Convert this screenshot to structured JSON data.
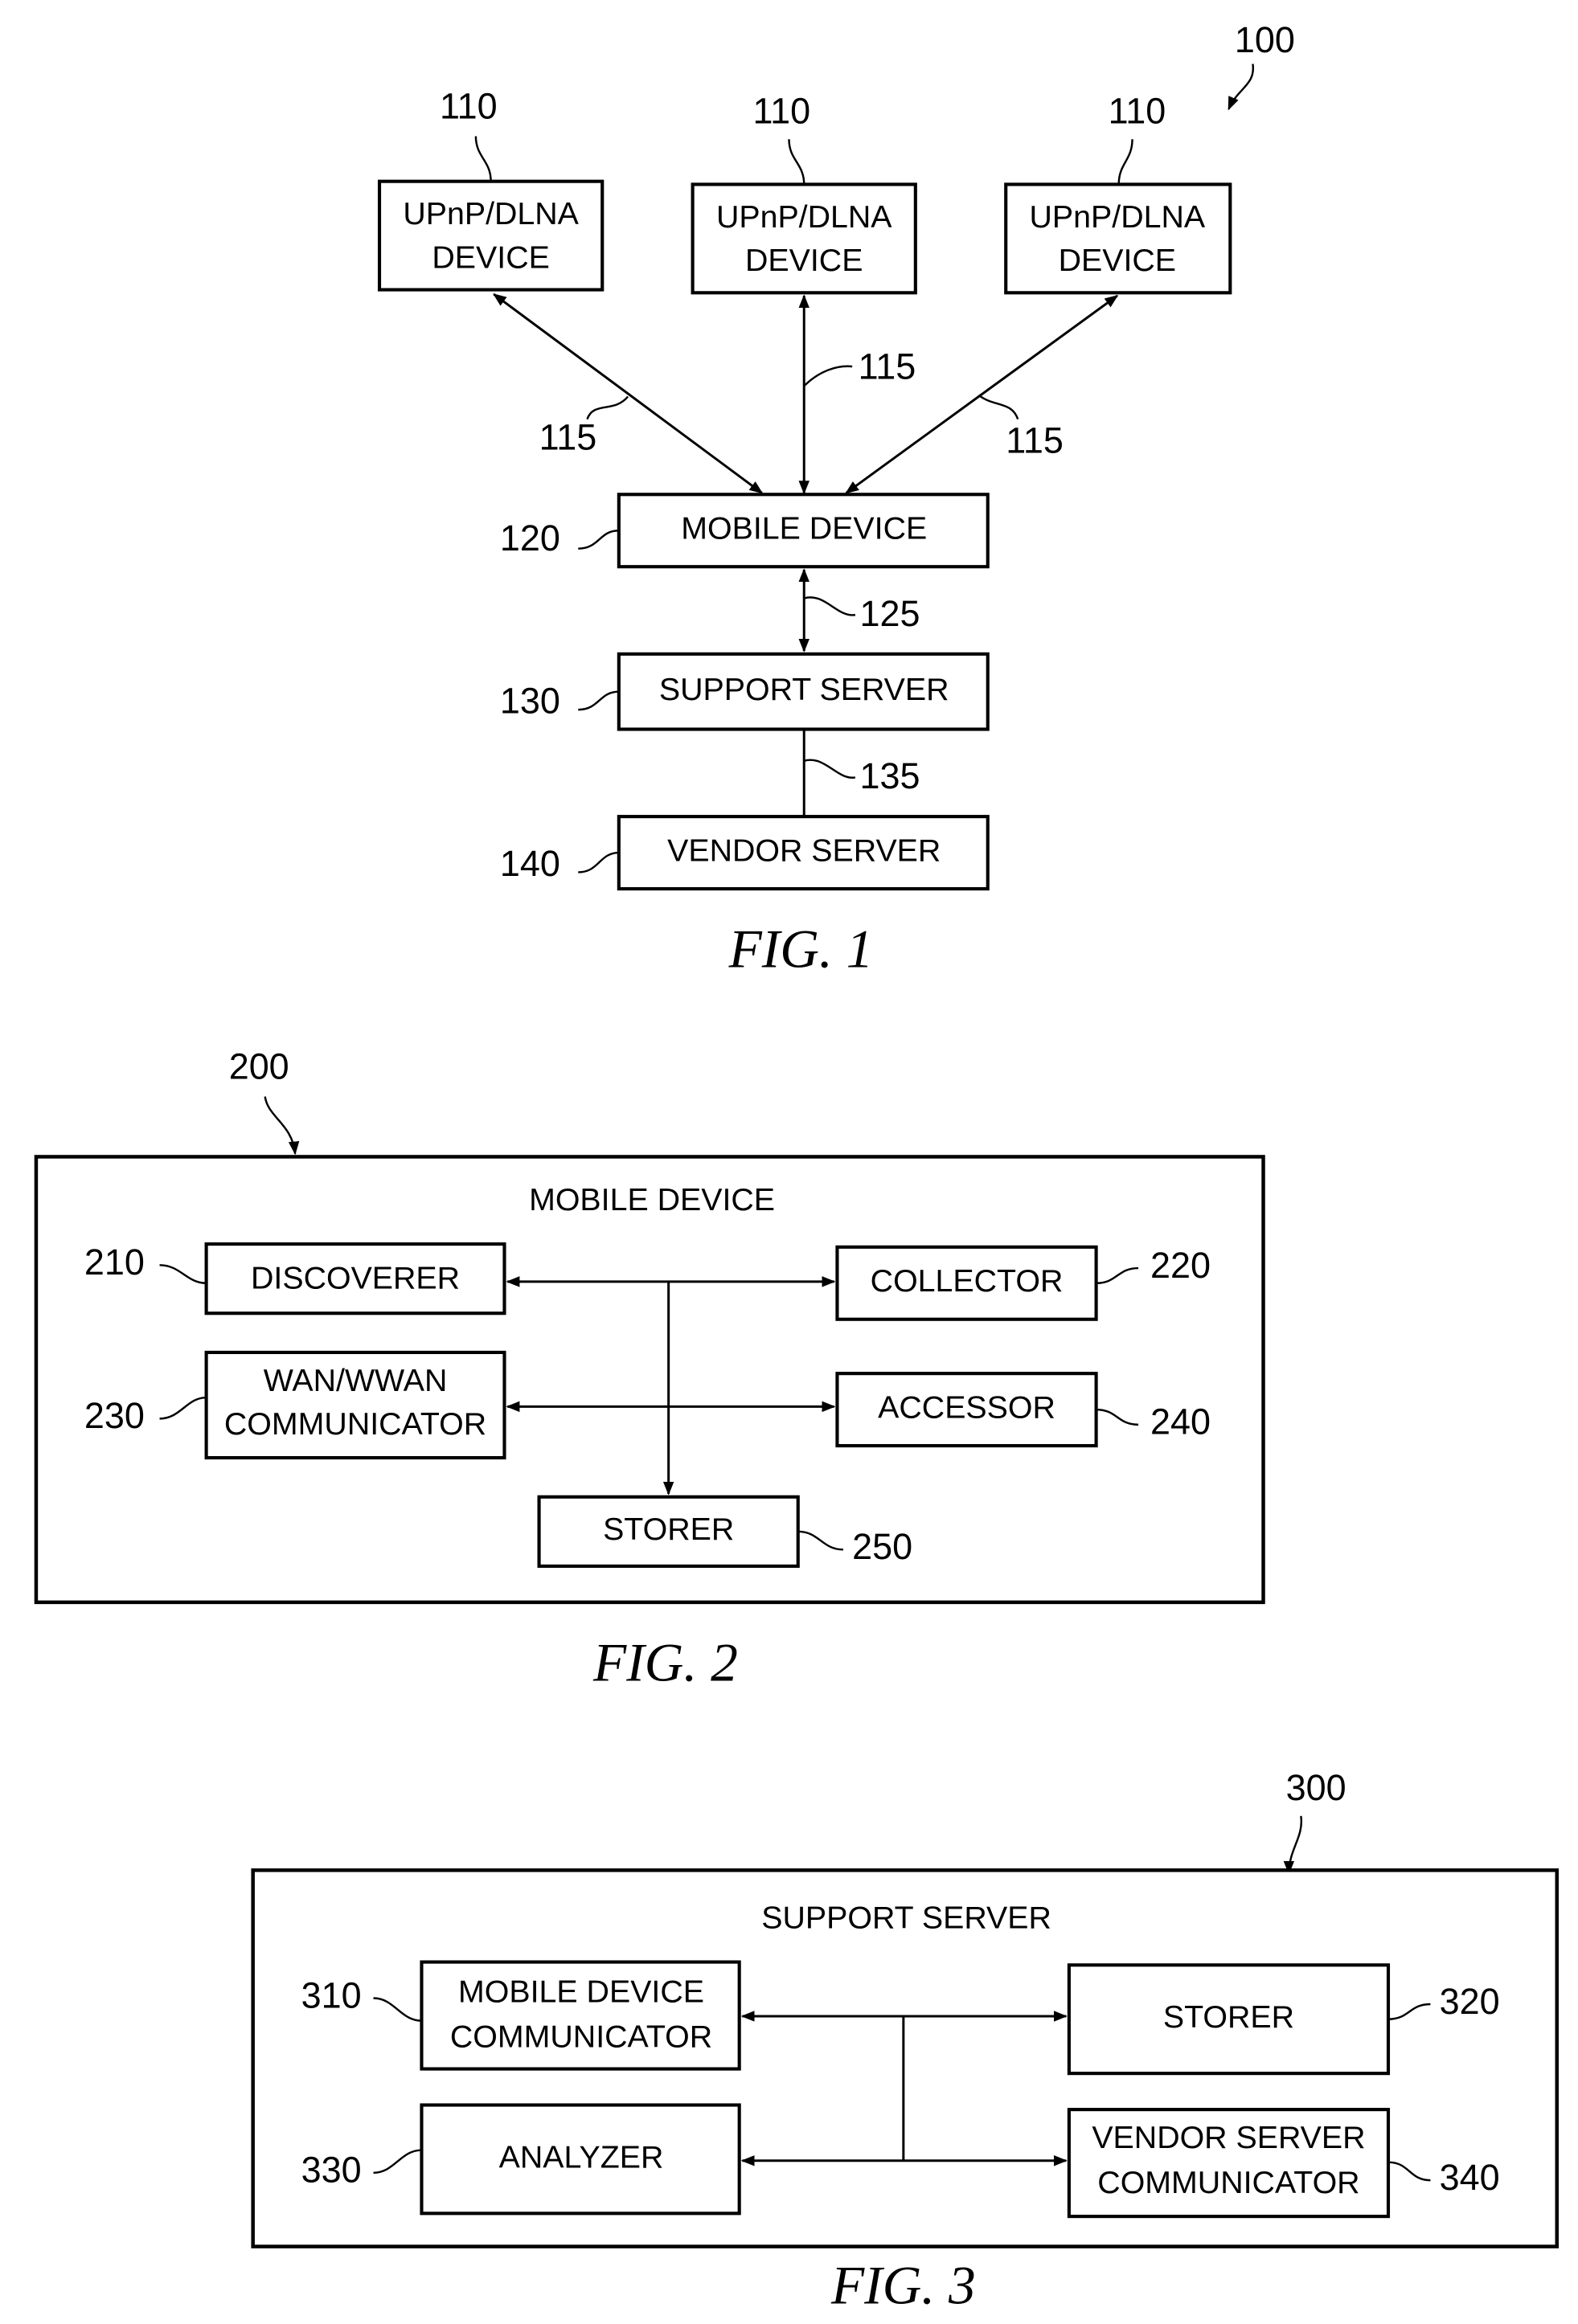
{
  "fig1": {
    "caption": "FIG. 1",
    "ref": "100",
    "devices": [
      {
        "ref": "110",
        "line1": "UPnP/DLNA",
        "line2": "DEVICE",
        "link_ref": "115"
      },
      {
        "ref": "110",
        "line1": "UPnP/DLNA",
        "line2": "DEVICE",
        "link_ref": "115"
      },
      {
        "ref": "110",
        "line1": "UPnP/DLNA",
        "line2": "DEVICE",
        "link_ref": "115"
      }
    ],
    "mobile": {
      "ref": "120",
      "label": "MOBILE DEVICE"
    },
    "link_mobile_support": "125",
    "support": {
      "ref": "130",
      "label": "SUPPORT SERVER"
    },
    "link_support_vendor": "135",
    "vendor": {
      "ref": "140",
      "label": "VENDOR SERVER"
    }
  },
  "fig2": {
    "caption": "FIG. 2",
    "ref": "200",
    "title": "MOBILE DEVICE",
    "discoverer": {
      "ref": "210",
      "label": "DISCOVERER"
    },
    "collector": {
      "ref": "220",
      "label": "COLLECTOR"
    },
    "communicator": {
      "ref": "230",
      "line1": "WAN/WWAN",
      "line2": "COMMUNICATOR"
    },
    "accessor": {
      "ref": "240",
      "label": "ACCESSOR"
    },
    "storer": {
      "ref": "250",
      "label": "STORER"
    }
  },
  "fig3": {
    "caption": "FIG. 3",
    "ref": "300",
    "title": "SUPPORT SERVER",
    "mobile_comm": {
      "ref": "310",
      "line1": "MOBILE DEVICE",
      "line2": "COMMUNICATOR"
    },
    "storer": {
      "ref": "320",
      "label": "STORER"
    },
    "analyzer": {
      "ref": "330",
      "label": "ANALYZER"
    },
    "vendor_comm": {
      "ref": "340",
      "line1": "VENDOR SERVER",
      "line2": "COMMUNICATOR"
    }
  }
}
